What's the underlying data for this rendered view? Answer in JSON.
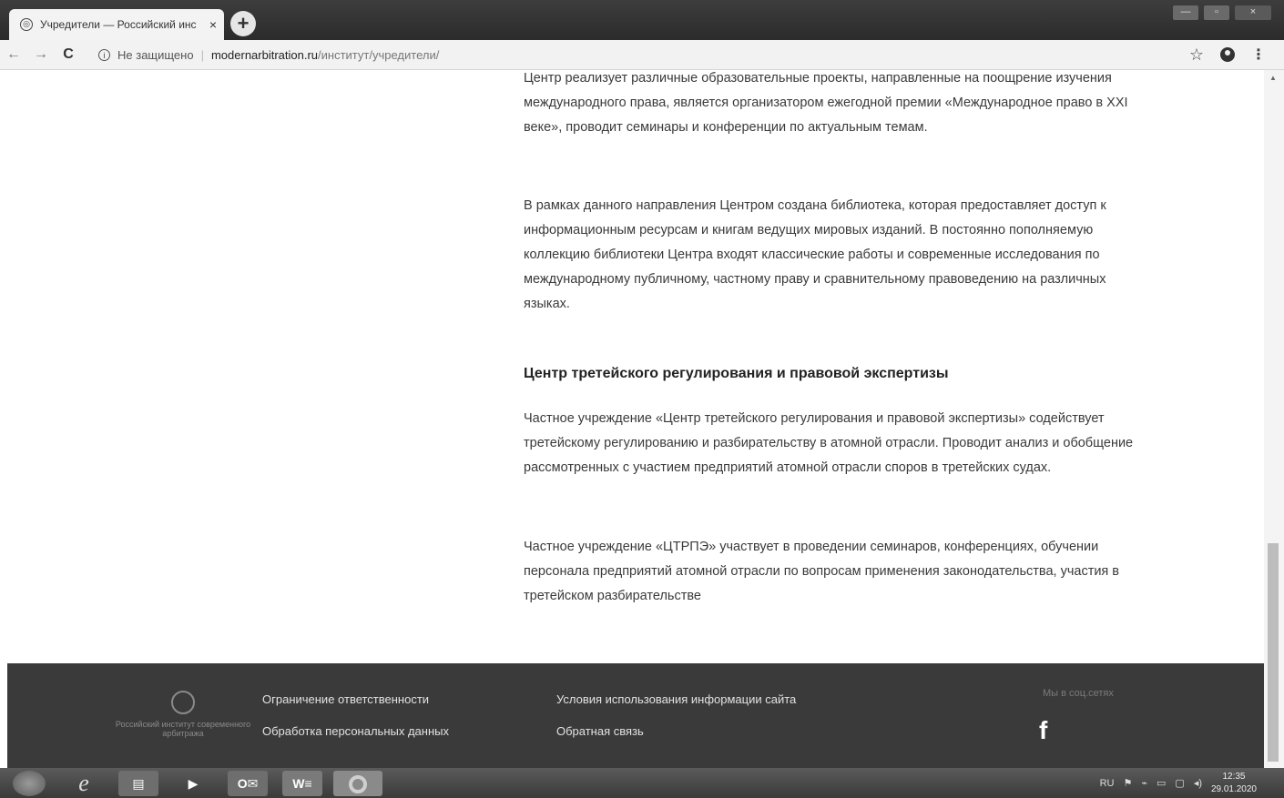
{
  "browser": {
    "tab_title": "Учредители — Российский инс",
    "tab_close": "×",
    "new_tab": "+",
    "not_secure": "Не защищено",
    "url_host": "modernarbitration.ru",
    "url_path": "/институт/учредители/",
    "window_controls": [
      "—",
      "▫",
      "×"
    ]
  },
  "content": {
    "paragraph_1": "Центр реализует различные образовательные проекты, направленные на поощрение изучения международного права, является организатором ежегодной премии «Международное право в XXI веке», проводит семинары и конференции по актуальным темам.",
    "paragraph_2": "В рамках данного направления Центром создана библиотека, которая предоставляет доступ к информационным ресурсам и книгам ведущих мировых изданий. В постоянно пополняемую коллекцию библиотеки Центра входят классические работы и современные исследования по международному публичному, частному праву и сравнительному правоведению на различных языках.",
    "heading": "Центр третейского регулирования и правовой экспертизы",
    "paragraph_3": "Частное учреждение «Центр третейского регулирования и правовой экспертизы» содействует третейскому регулированию и разбирательству в атомной отрасли. Проводит анализ и обобщение рассмотренных с участием предприятий атомной отрасли споров в третейских судах.",
    "paragraph_4": "Частное учреждение «ЦТРПЭ» участвует в проведении семинаров, конференциях, обучении персонала предприятий атомной отрасли по вопросам применения законодательства, участия в третейском разбирательстве"
  },
  "footer": {
    "logo_text": "Российский институт современного арбитража",
    "link_disclaimer": "Ограничение ответственности",
    "link_personal_data": "Обработка персональных данных",
    "link_terms": "Условия использования информации сайта",
    "link_feedback": "Обратная связь",
    "social_label": "Мы в соц.сетях",
    "facebook": "f"
  },
  "taskbar": {
    "language": "RU",
    "time": "12:35",
    "date": "29.01.2020"
  }
}
